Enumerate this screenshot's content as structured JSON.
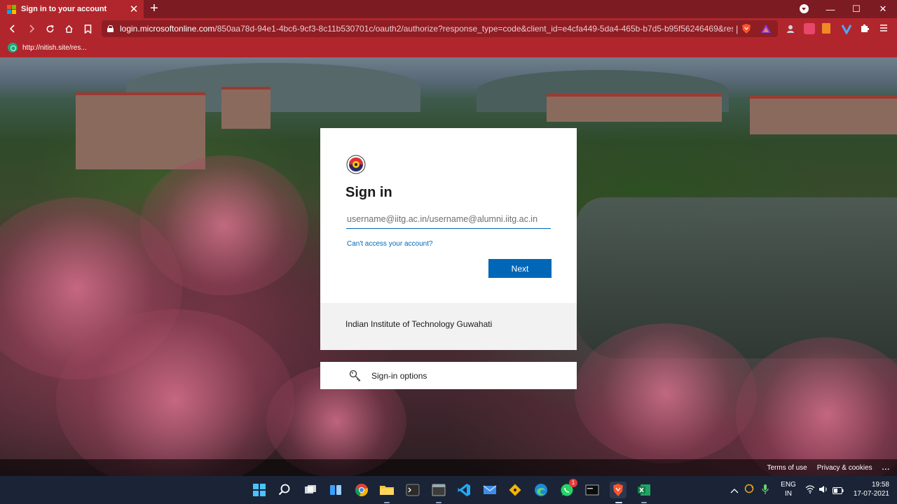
{
  "browser": {
    "tab_title": "Sign in to your account",
    "tab_close": "✕",
    "new_tab": "+",
    "url_host": "login.microsoftonline.com",
    "url_rest": "/850aa78d-94e1-4bc6-9cf3-8c11b530701c/oauth2/authorize?response_type=code&client_id=e4cfa449-5da4-465b-b7d5-b95f56246469&res...",
    "url_separator": "|",
    "bookmark_label": "http://nitish.site/res...",
    "minimize": "—",
    "maximize": "☐",
    "close": "✕",
    "accent_color": "#b1262c"
  },
  "signin": {
    "title": "Sign in",
    "username_placeholder": "username@iitg.ac.in/username@alumni.iitg.ac.in",
    "username_value": "",
    "cant_access_link": "Can't access your account?",
    "next_button": "Next",
    "org_name": "Indian Institute of Technology Guwahati",
    "options_label": "Sign-in options",
    "button_color": "#0067b8"
  },
  "page_footer": {
    "terms": "Terms of use",
    "privacy": "Privacy & cookies",
    "more": "..."
  },
  "taskbar": {
    "language_line1": "ENG",
    "language_line2": "IN",
    "time": "19:58",
    "date": "17-07-2021",
    "whatsapp_badge": "1"
  }
}
